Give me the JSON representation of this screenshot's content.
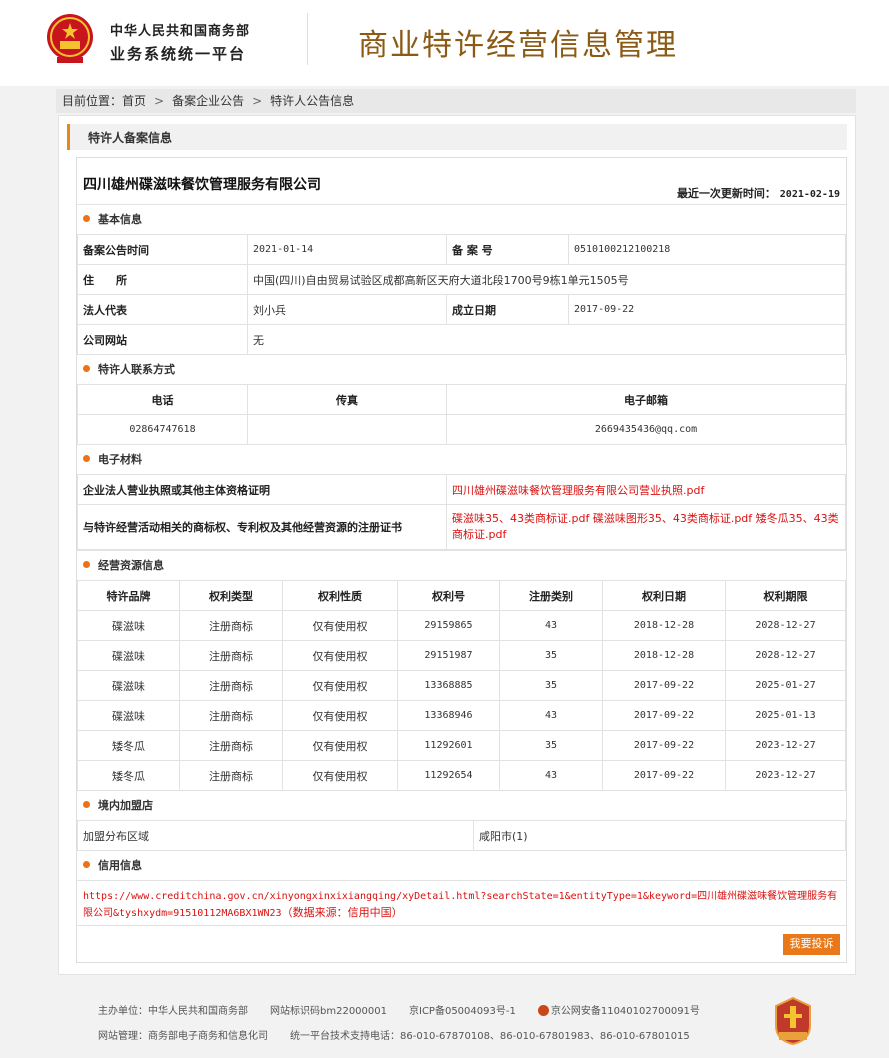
{
  "header": {
    "gov_line1": "中华人民共和国商务部",
    "gov_line2": "业务系统统一平台",
    "system_title": "商业特许经营信息管理"
  },
  "breadcrumb": {
    "prefix": "目前位置：",
    "items": [
      "首页",
      "备案企业公告",
      "特许人公告信息"
    ],
    "separator": ">"
  },
  "panel_title": "特许人备案信息",
  "company": {
    "name": "四川雄州碟滋味餐饮管理服务有限公司",
    "updated_label": "最近一次更新时间：",
    "updated_date": "2021-02-19"
  },
  "basic": {
    "section_title": "基本信息",
    "announce_label": "备案公告时间",
    "announce_value": "2021-01-14",
    "record_no_label": "备 案 号",
    "record_no_value": "0510100212100218",
    "address_label": "住　　所",
    "address_value": "中国(四川)自由贸易试验区成都高新区天府大道北段1700号9栋1单元1505号",
    "legal_label": "法人代表",
    "legal_value": "刘小兵",
    "founded_label": "成立日期",
    "founded_value": "2017-09-22",
    "website_label": "公司网站",
    "website_value": "无"
  },
  "contact": {
    "section_title": "特许人联系方式",
    "headers": [
      "电话",
      "传真",
      "电子邮箱"
    ],
    "phone": "02864747618",
    "fax": "",
    "email": "2669435436@qq.com"
  },
  "materials": {
    "section_title": "电子材料",
    "license_label": "企业法人营业执照或其他主体资格证明",
    "license_file": "四川雄州碟滋味餐饮管理服务有限公司营业执照.pdf",
    "ip_label": "与特许经营活动相关的商标权、专利权及其他经营资源的注册证书",
    "ip_files": "碟滋味35、43类商标证.pdf 碟滋味图形35、43类商标证.pdf 矮冬瓜35、43类商标证.pdf"
  },
  "resources": {
    "section_title": "经营资源信息",
    "headers": [
      "特许品牌",
      "权利类型",
      "权利性质",
      "权利号",
      "注册类别",
      "权利日期",
      "权利期限"
    ],
    "rows": [
      [
        "碟滋味",
        "注册商标",
        "仅有使用权",
        "29159865",
        "43",
        "2018-12-28",
        "2028-12-27"
      ],
      [
        "碟滋味",
        "注册商标",
        "仅有使用权",
        "29151987",
        "35",
        "2018-12-28",
        "2028-12-27"
      ],
      [
        "碟滋味",
        "注册商标",
        "仅有使用权",
        "13368885",
        "35",
        "2017-09-22",
        "2025-01-27"
      ],
      [
        "碟滋味",
        "注册商标",
        "仅有使用权",
        "13368946",
        "43",
        "2017-09-22",
        "2025-01-13"
      ],
      [
        "矮冬瓜",
        "注册商标",
        "仅有使用权",
        "11292601",
        "35",
        "2017-09-22",
        "2023-12-27"
      ],
      [
        "矮冬瓜",
        "注册商标",
        "仅有使用权",
        "11292654",
        "43",
        "2017-09-22",
        "2023-12-27"
      ]
    ]
  },
  "franchise": {
    "section_title": "境内加盟店",
    "region_label": "加盟分布区域",
    "region_value": "咸阳市(1)"
  },
  "credit": {
    "section_title": "信用信息",
    "url": "https://www.creditchina.gov.cn/xinyongxinxixiangqing/xyDetail.html?searchState=1&entityType=1&keyword=四川雄州碟滋味餐饮管理服务有限公司&tyshxydm=91510112MA6BX1WN23",
    "source_note": "（数据来源：信用中国）"
  },
  "complain_label": "我要投诉",
  "footer": {
    "host": "主办单位：中华人民共和国商务部",
    "site_code": "网站标识码bm22000001",
    "icp": "京ICP备05004093号-1",
    "police": "京公网安备11040102700091号",
    "manage": "网站管理：商务部电子商务和信息化司",
    "support": "统一平台技术支持电话：86-010-67870108、86-010-67801983、86-010-67801015",
    "badge_text": "党政机关"
  }
}
